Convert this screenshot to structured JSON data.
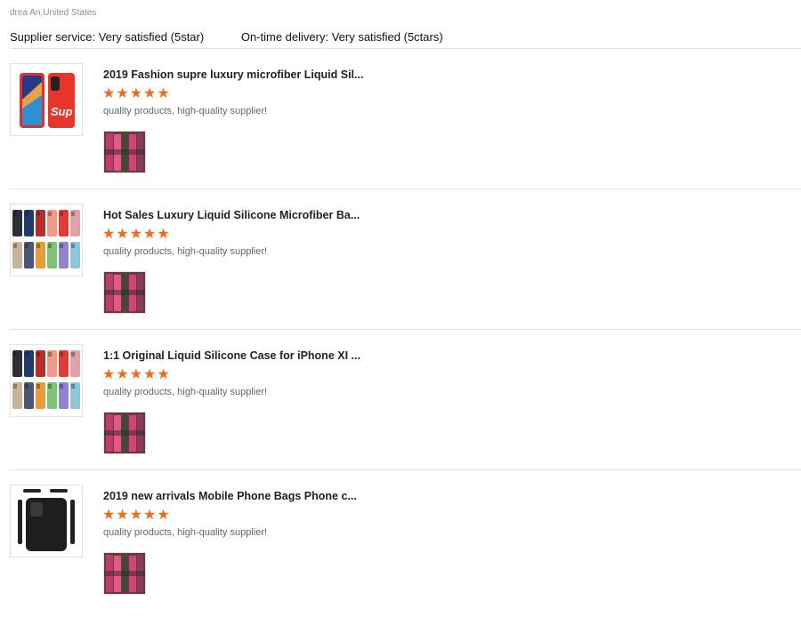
{
  "header": {
    "user_location": "drea An,United States",
    "supplier_service": "Supplier service: Very satisfied (5star)",
    "on_time_delivery": "On-time delivery: Very satisfied (5ctars)"
  },
  "reviews": [
    {
      "title": "2019 Fashion supre luxury microfiber Liquid Sil...",
      "stars": "★★★★★",
      "rating": 5,
      "comment": "quality products, high-quality supplier!",
      "thumb_icon": "phone-case-supreme-thumbnail-icon"
    },
    {
      "title": "Hot Sales Luxury Liquid Silicone Microfiber Ba...",
      "stars": "★★★★★",
      "rating": 5,
      "comment": "quality products, high-quality supplier!",
      "thumb_icon": "colorful-phone-cases-thumbnail-icon"
    },
    {
      "title": "1:1 Original Liquid Silicone Case for iPhone XI ...",
      "stars": "★★★★★",
      "rating": 5,
      "comment": "quality products, high-quality supplier!",
      "thumb_icon": "colorful-phone-cases-thumbnail-icon"
    },
    {
      "title": "2019 new arrivals Mobile Phone Bags Phone c...",
      "stars": "★★★★★",
      "rating": 5,
      "comment": "quality products, high-quality supplier!",
      "thumb_icon": "black-phone-case-thumbnail-icon"
    }
  ],
  "colors": {
    "star": "#f26a1b",
    "divider": "#e3e3e3",
    "muted_text": "#8c8c8c",
    "case_palette": [
      "#2b2f3a",
      "#1f3a6b",
      "#b62f2f",
      "#ee9c88",
      "#e23b33",
      "#e0a0a8",
      "#c7b39b",
      "#4b5675",
      "#e79b3b",
      "#7cc27a",
      "#8f85cc",
      "#8ec6d8"
    ]
  }
}
